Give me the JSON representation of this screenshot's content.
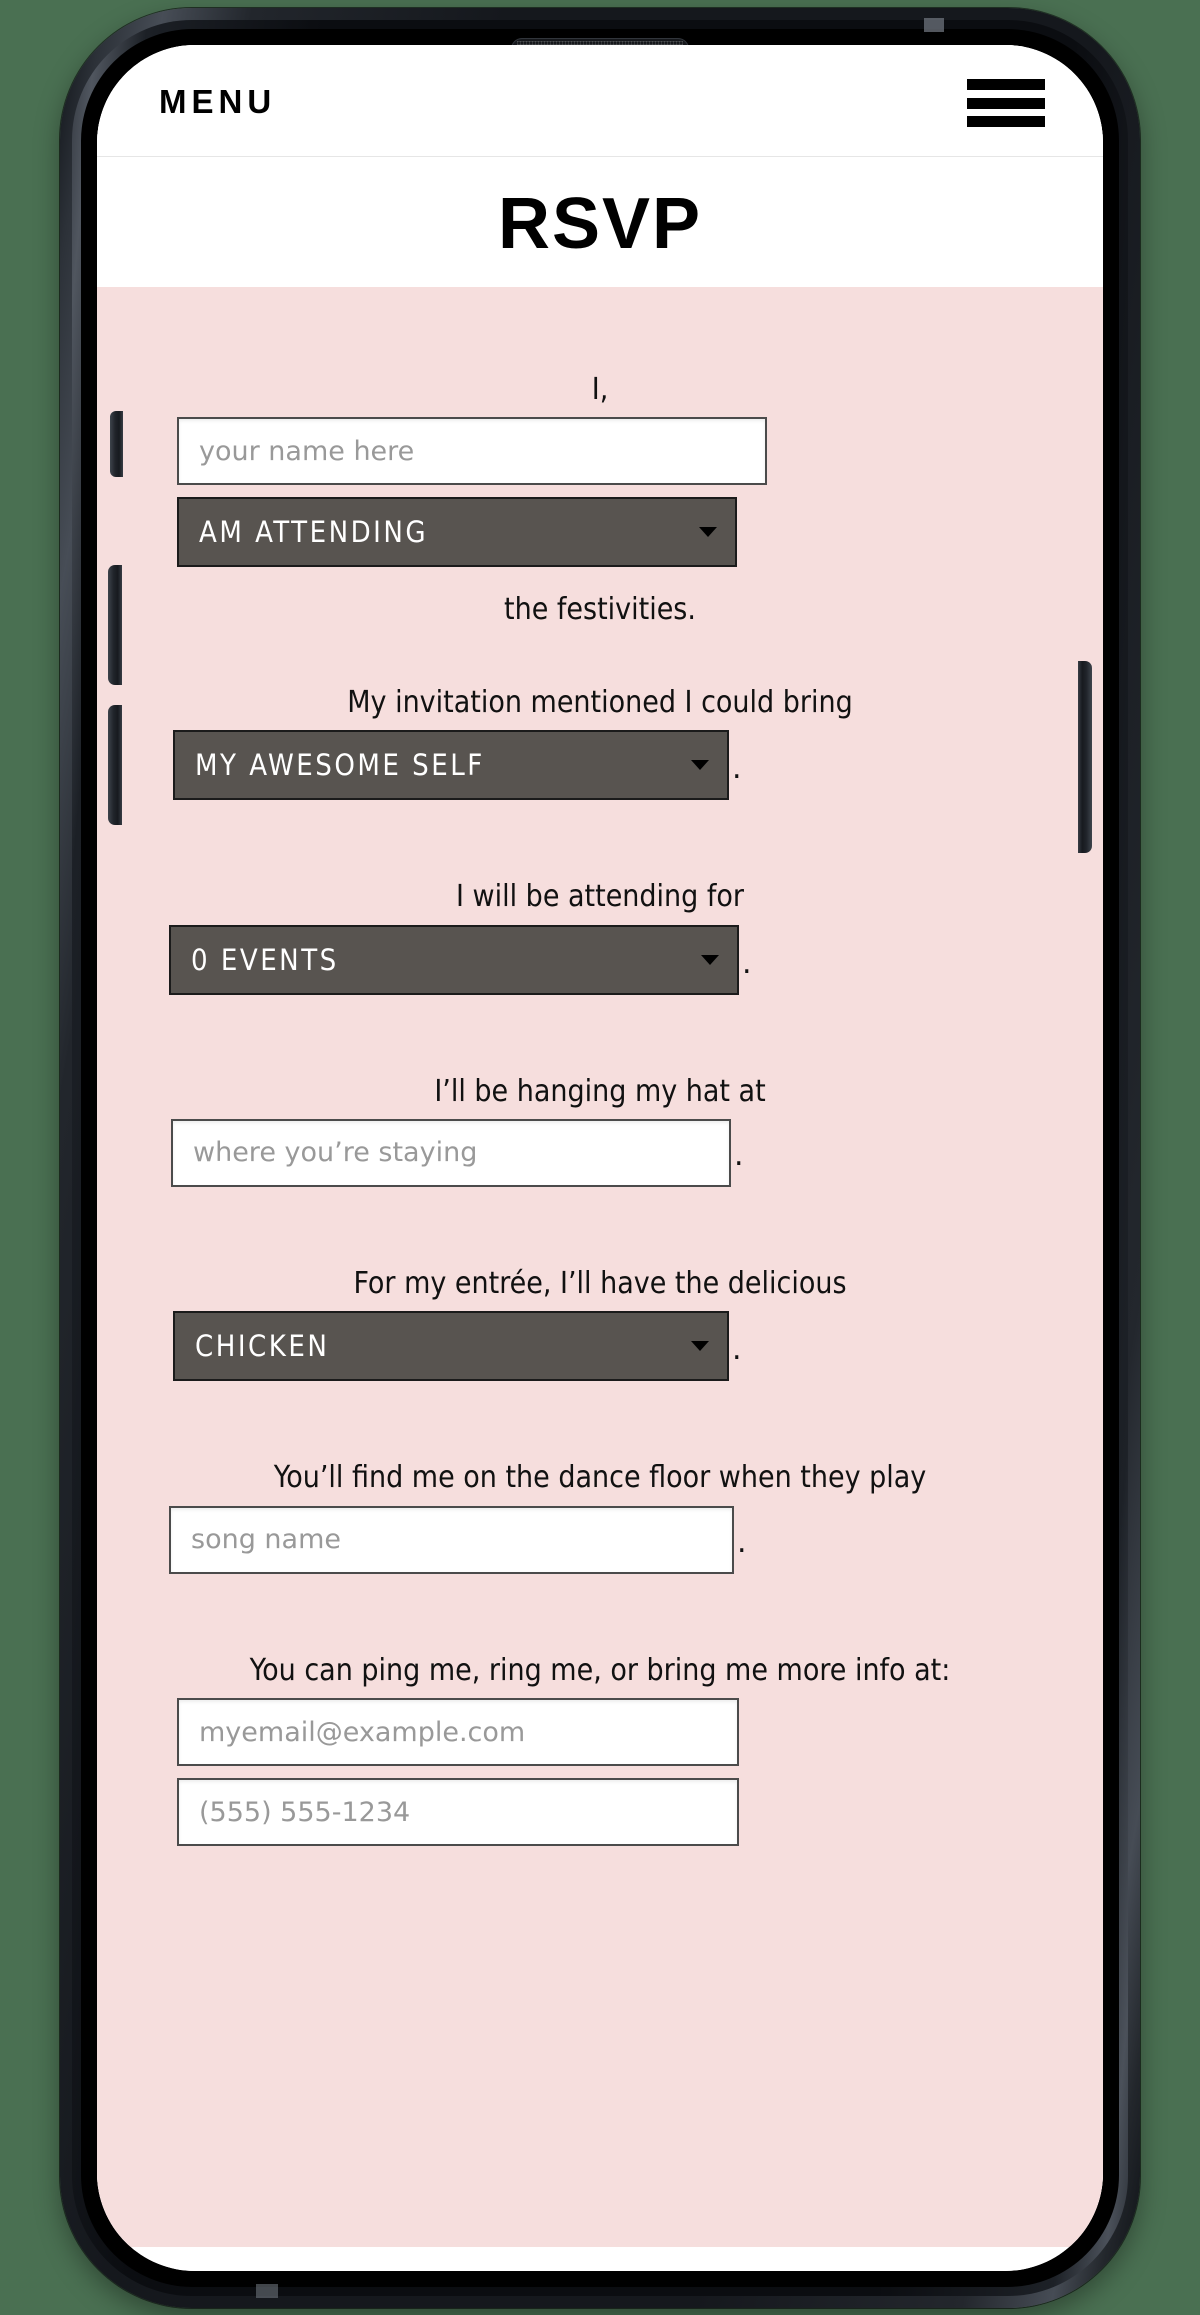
{
  "background_color": "#4a7052",
  "theme": {
    "form_background": "#f6dedd",
    "select_background": "#585450",
    "select_text": "#ffffff",
    "placeholder_text": "#999999",
    "body_text": "#111111"
  },
  "topnav": {
    "menu_label": "MENU",
    "hamburger_icon": "hamburger-icon"
  },
  "page": {
    "title": "RSVP"
  },
  "form": {
    "fields": [
      {
        "id": "name",
        "label": "I,",
        "control": "text",
        "placeholder": "your name here",
        "value": "",
        "suffix": ""
      },
      {
        "id": "attendance",
        "label": "",
        "control": "select",
        "value": "AM ATTENDING",
        "caret_icon": "chevron-down-icon",
        "suffix": ""
      },
      {
        "id": "festivities-text",
        "label": "the festivities.",
        "control": "none"
      },
      {
        "id": "guests",
        "label": "My invitation mentioned I could bring",
        "control": "select",
        "value": "MY AWESOME SELF",
        "caret_icon": "chevron-down-icon",
        "suffix": "."
      },
      {
        "id": "events",
        "label": "I will be attending for",
        "control": "select",
        "value": "0 EVENTS",
        "caret_icon": "chevron-down-icon",
        "suffix": "."
      },
      {
        "id": "lodging",
        "label": "I’ll be hanging my hat at",
        "control": "text",
        "placeholder": "where you’re staying",
        "value": "",
        "suffix": "."
      },
      {
        "id": "entree",
        "label": "For my entrée, I’ll have the delicious",
        "control": "select",
        "value": "CHICKEN",
        "caret_icon": "chevron-down-icon",
        "suffix": "."
      },
      {
        "id": "song",
        "label": "You’ll find me on the dance floor when they play",
        "control": "text",
        "placeholder": "song name",
        "value": "",
        "suffix": "."
      },
      {
        "id": "contact",
        "label": "You can ping me, ring me, or bring me more info at:",
        "control": "text",
        "placeholder": "myemail@example.com",
        "value": "",
        "suffix": ""
      },
      {
        "id": "phone",
        "label": "",
        "control": "text",
        "placeholder": "(555) 555-1234",
        "value": "",
        "suffix": ""
      }
    ]
  },
  "device": {
    "frame": "smartphone-mockup",
    "buttons": [
      "mute-switch",
      "volume-up",
      "volume-down",
      "power"
    ]
  }
}
